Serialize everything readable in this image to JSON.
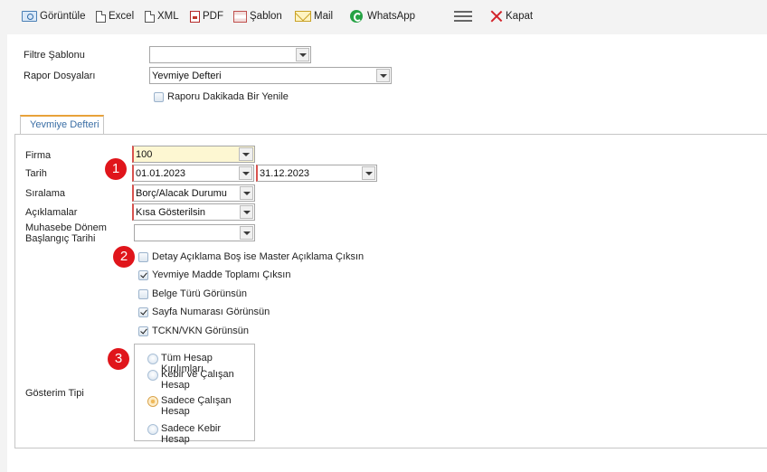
{
  "toolbar": {
    "view": {
      "label": "Görüntüle",
      "icon": "view-report-icon"
    },
    "excel": {
      "label": "Excel",
      "icon": "excel-icon"
    },
    "xml": {
      "label": "XML",
      "icon": "xml-icon"
    },
    "pdf": {
      "label": "PDF",
      "icon": "pdf-icon"
    },
    "template": {
      "label": "Şablon",
      "icon": "template-icon"
    },
    "mail": {
      "label": "Mail",
      "icon": "mail-icon"
    },
    "whatsapp": {
      "label": "WhatsApp",
      "icon": "whatsapp-icon"
    },
    "menu": {
      "icon": "hamburger-menu-icon"
    },
    "close": {
      "label": "Kapat",
      "icon": "close-icon"
    }
  },
  "top_form": {
    "filter_template": {
      "label": "Filtre Şablonu",
      "value": ""
    },
    "report_files": {
      "label": "Rapor Dosyaları",
      "value": "Yevmiye Defteri"
    },
    "auto_refresh": {
      "label": "Raporu Dakikada Bir Yenile",
      "checked": false
    }
  },
  "tab": {
    "label": "Yevmiye Defteri"
  },
  "fields": {
    "firma": {
      "label": "Firma",
      "value": "100"
    },
    "tarih": {
      "label": "Tarih",
      "start": "01.01.2023",
      "end": "31.12.2023"
    },
    "siralama": {
      "label": "Sıralama",
      "value": "Borç/Alacak Durumu"
    },
    "aciklamalar": {
      "label": "Açıklamalar",
      "value": "Kısa Gösterilsin"
    },
    "donem_baslangic": {
      "label_line1": "Muhasebe Dönem",
      "label_line2": "Başlangıç Tarihi",
      "value": ""
    }
  },
  "options": [
    {
      "label": "Detay Açıklama Boş ise Master Açıklama Çıksın",
      "checked": false
    },
    {
      "label": "Yevmiye Madde Toplamı Çıksın",
      "checked": true
    },
    {
      "label": "Belge Türü Görünsün",
      "checked": false
    },
    {
      "label": "Sayfa Numarası Görünsün",
      "checked": true
    },
    {
      "label": "TCKN/VKN Görünsün",
      "checked": true
    }
  ],
  "display_type": {
    "label": "Gösterim Tipi",
    "options": [
      {
        "label": "Tüm Hesap Kırılımları",
        "selected": false
      },
      {
        "label": "Kebir ve Çalışan Hesap",
        "selected": false
      },
      {
        "label": "Sadece Çalışan Hesap",
        "selected": true
      },
      {
        "label": "Sadece Kebir Hesap",
        "selected": false
      }
    ]
  },
  "badges": [
    "1",
    "2",
    "3"
  ],
  "colors": {
    "accent_tab": "#e8a23a",
    "badge": "#e0151b",
    "firma_bg": "#fdf7d2",
    "required_border": "#d9534f"
  }
}
